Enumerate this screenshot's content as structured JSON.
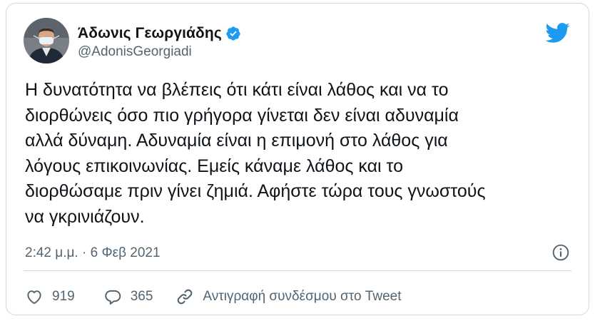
{
  "author": {
    "display_name": "Άδωνις Γεωργιάδης",
    "handle": "@AdonisGeorgiadi",
    "verified": true,
    "avatar_icon": "profile-photo-avatar"
  },
  "brand": {
    "logo_icon": "twitter-bird-icon",
    "color": "#1d9bf0"
  },
  "tweet": {
    "lines": [
      "Η δυνατότητα να βλέπεις ότι κάτι είναι λάθος και να το",
      "διορθώνεις όσο πιο γρήγορα γίνεται δεν είναι αδυναμία",
      "αλλά δύναμη. Αδυναμία είναι η επιμονή στο λάθος για",
      "λόγους επικοινωνίας. Εμείς κάναμε λάθος και το",
      "διορθώσαμε πριν γίνει ζημιά. Αφήστε τώρα τους γνωστούς",
      "να γκρινιάζουν."
    ],
    "timestamp": "2:42 μ.μ. · 6 Φεβ 2021"
  },
  "actions": {
    "like_count": "919",
    "reply_count": "365",
    "copy_link_label": "Αντιγραφή συνδέσμου στο Tweet"
  },
  "colors": {
    "text_primary": "#0f1419",
    "text_secondary": "#536471",
    "border": "#cfd9de",
    "verified": "#1d9bf0"
  }
}
